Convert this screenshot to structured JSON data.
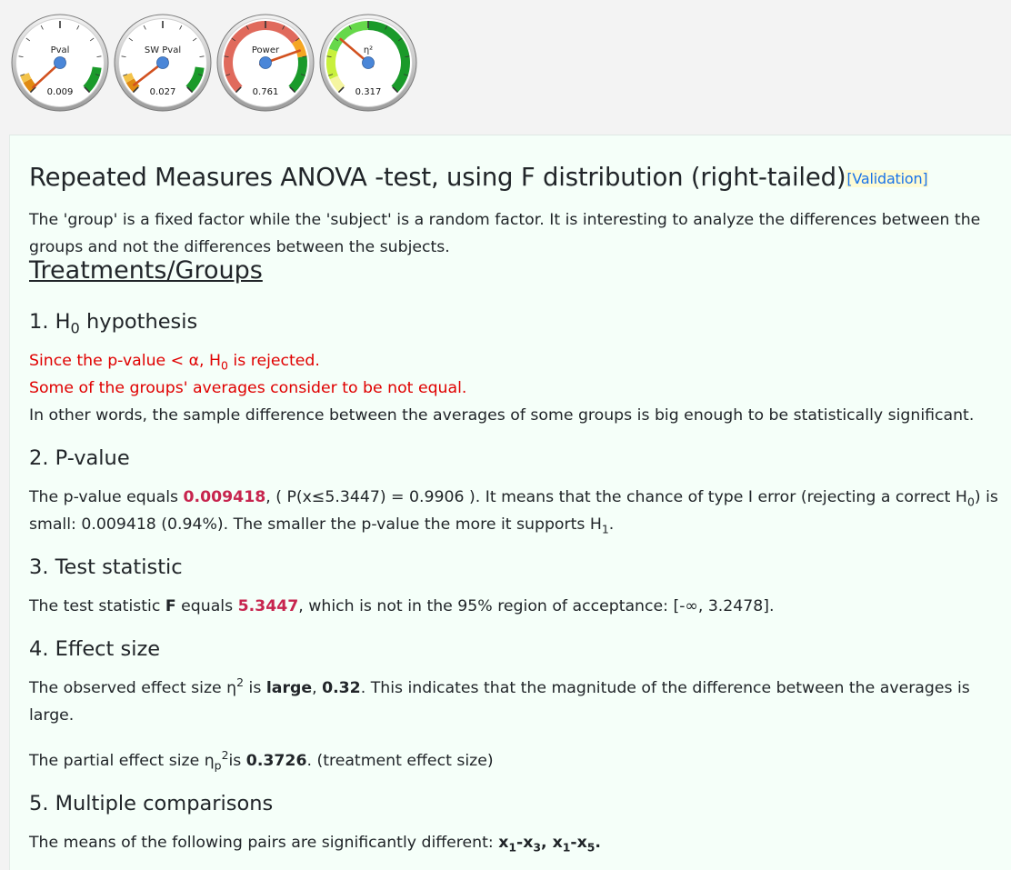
{
  "gauges": [
    {
      "label": "Pval",
      "value_text": "0.009",
      "value": 0.009
    },
    {
      "label": "SW Pval",
      "value_text": "0.027",
      "value": 0.027
    },
    {
      "label": "Power",
      "value_text": "0.761",
      "value": 0.761
    },
    {
      "label": "η²",
      "value_text": "0.317",
      "value": 0.317
    }
  ],
  "colors": {
    "accent": "#c7254e",
    "reject": "#e00000",
    "link": "#1a73e8",
    "panel_bg": "#f5fff9"
  },
  "title": "Repeated Measures ANOVA -test, using F distribution (right-tailed)",
  "validation_link": "[Validation]",
  "intro": "The 'group' is a fixed factor while the 'subject' is a random factor. It is interesting to analyze the differences between the groups and not the differences between the subjects.",
  "section_heading": "Treatments/Groups",
  "s1": {
    "heading_pre": "1. H",
    "heading_sub": "0",
    "heading_post": " hypothesis",
    "line1_pre": "Since the p-value < α, H",
    "line1_sub": "0",
    "line1_post": " is rejected.",
    "line2": "Some of the groups' averages consider to be not equal.",
    "line3": "In other words, the sample difference between the averages of some groups is big enough to be statistically significant."
  },
  "s2": {
    "heading": "2. P-value",
    "t1": "The p-value equals ",
    "pvalue": "0.009418",
    "t2": ", ( P(x≤5.3447) = 0.9906 ). It means that the chance of type I error (rejecting a correct H",
    "sub0": "0",
    "t3": ") is small: 0.009418 (0.94%). The smaller the p-value the more it supports H",
    "sub1": "1",
    "t4": "."
  },
  "s3": {
    "heading": "3. Test statistic",
    "t1": "The test statistic ",
    "stat_name": "F",
    "t2": " equals ",
    "stat_value": "5.3447",
    "t3": ", which is not in the 95% region of acceptance: [-∞, 3.2478]."
  },
  "s4": {
    "heading": "4. Effect size",
    "t1": "The observed effect size η",
    "sup": "2",
    "t2": " is ",
    "size_word": "large",
    "t3": ", ",
    "size_value": "0.32",
    "t4": ". This indicates that the magnitude of the difference between the averages is large.",
    "p2_t1": "The partial effect size η",
    "p2_sub": "p",
    "p2_sup": "2",
    "p2_t2": "is ",
    "p2_value": "0.3726",
    "p2_t3": ". (treatment effect size)"
  },
  "s5": {
    "heading": "5. Multiple comparisons",
    "t1": "The means of the following pairs are significantly different: ",
    "pairs": [
      {
        "a": "x",
        "a_sub": "1",
        "dash": "-",
        "b": "x",
        "b_sub": "3",
        "sep": ", "
      },
      {
        "a": "x",
        "a_sub": "1",
        "dash": "-",
        "b": "x",
        "b_sub": "5",
        "sep": "."
      }
    ]
  }
}
